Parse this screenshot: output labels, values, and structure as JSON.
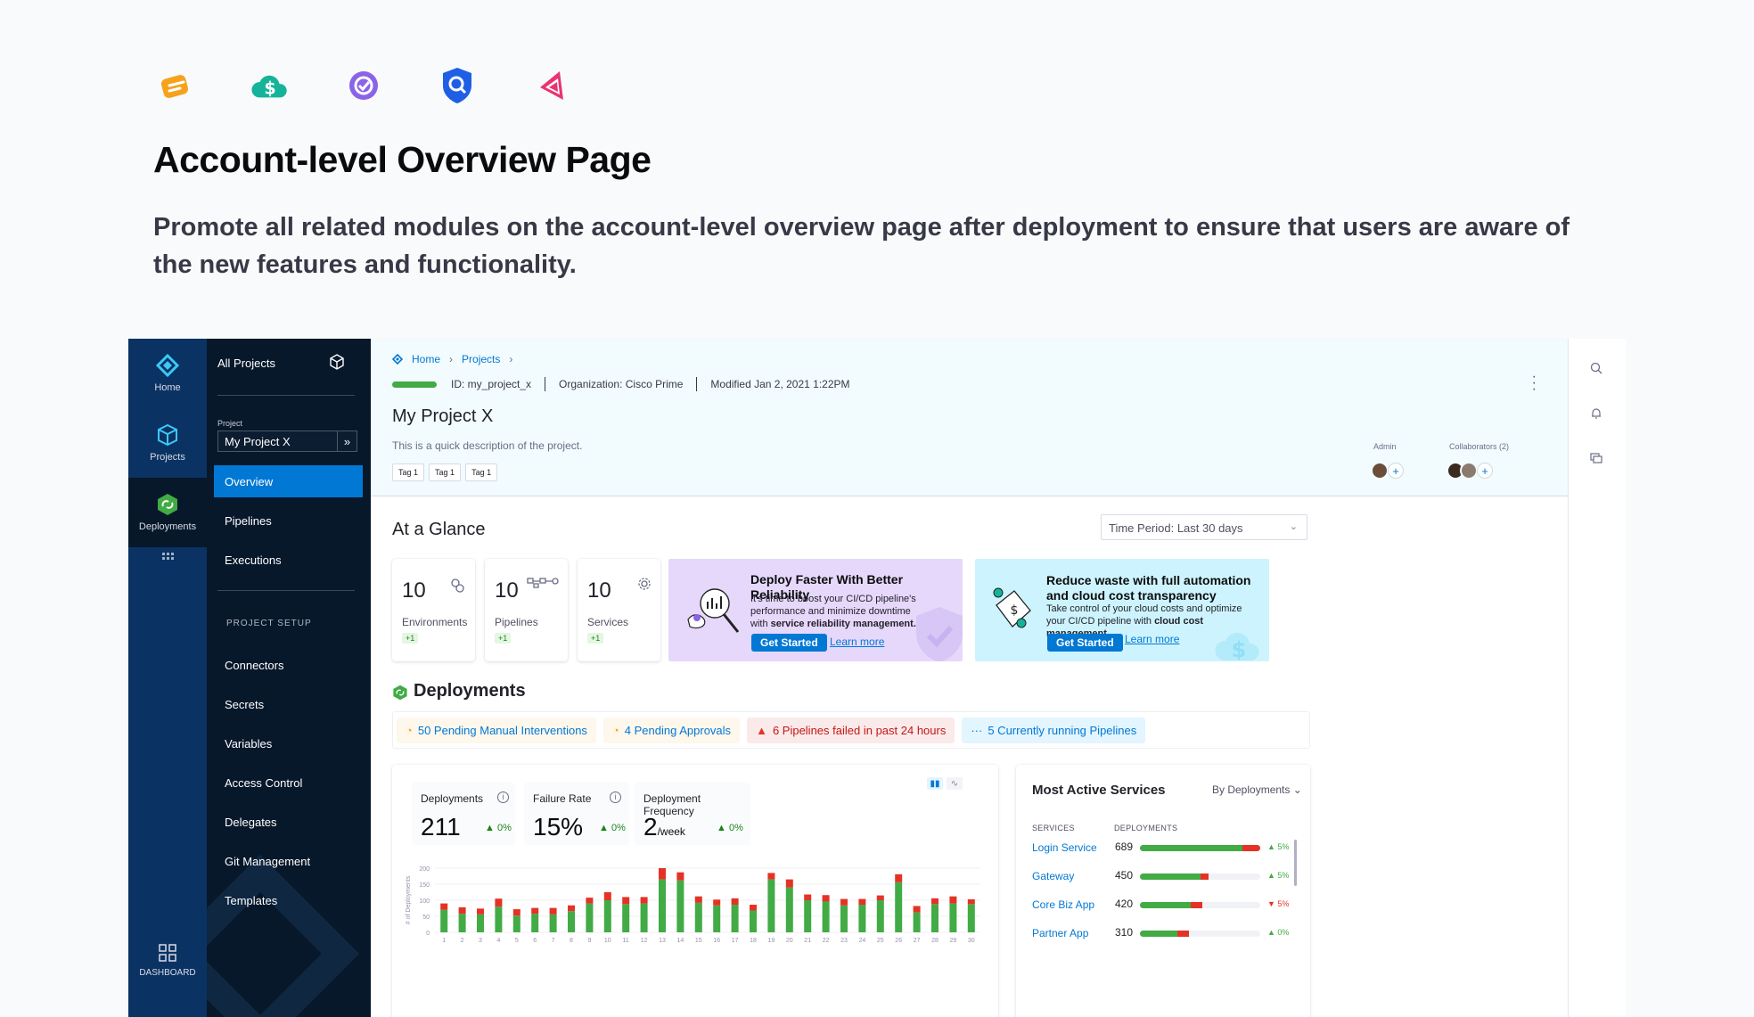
{
  "colors": {
    "accent": "#0278d5",
    "nav_dark": "#0a3364",
    "nav_darker": "#07182b",
    "success": "#42ab45",
    "danger": "#e43326"
  },
  "module_icons": [
    "feature-flags-icon",
    "cloud-cost-icon",
    "service-reliability-icon",
    "security-testing-icon",
    "chaos-engineering-icon"
  ],
  "headline": "Account-level Overview Page",
  "subheadline": "Promote all related modules on the account-level overview page after deployment to ensure that users are aware of the new features and functionality.",
  "nav_primary": {
    "home": "Home",
    "projects": "Projects",
    "deployments": "Deployments",
    "dashboard": "DASHBOARD"
  },
  "nav_secondary": {
    "all_projects": "All Projects",
    "project_label": "Project",
    "project_value": "My Project X",
    "project_chev": "»",
    "links": [
      "Overview",
      "Pipelines",
      "Executions"
    ],
    "setup_title": "PROJECT SETUP",
    "setup_links": [
      "Connectors",
      "Secrets",
      "Variables",
      "Access Control",
      "Delegates",
      "Git Management",
      "Templates"
    ]
  },
  "header": {
    "breadcrumb": [
      "Home",
      "Projects"
    ],
    "id": "ID: my_project_x",
    "org": "Organization: Cisco Prime",
    "modified": "Modified Jan 2, 2021 1:22PM",
    "title": "My Project X",
    "description": "This is a quick description of the project.",
    "tags": [
      "Tag 1",
      "Tag 1",
      "Tag 1"
    ],
    "admin_label": "Admin",
    "collaborators_label": "Collaborators (2)",
    "add": "+"
  },
  "glance": {
    "title": "At a Glance",
    "time_period": "Time Period: Last 30 days",
    "stats": [
      {
        "value": "10",
        "label": "Environments",
        "delta": "+1",
        "icon": "environments-icon"
      },
      {
        "value": "10",
        "label": "Pipelines",
        "delta": "+1",
        "icon": "pipelines-icon"
      },
      {
        "value": "10",
        "label": "Services",
        "delta": "+1",
        "icon": "services-gear-icon"
      }
    ],
    "promo_reliability": {
      "title": "Deploy Faster With Better Reliability",
      "text": "It's time to boost your CI/CD pipeline's performance and minimize downtime with",
      "bold": "service reliability management.",
      "cta": "Get Started",
      "link": "Learn more"
    },
    "promo_cost": {
      "title": "Reduce waste with full automation and cloud cost transparency",
      "text": "Take control of your cloud costs and optimize your CI/CD pipeline with",
      "bold": "cloud cost management.",
      "cta": "Get Started",
      "link": "Learn more"
    }
  },
  "deployments": {
    "title": "Deployments",
    "badges": [
      "50 Pending Manual Interventions",
      "4 Pending Approvals",
      "6 Pipelines failed in past 24 hours",
      "5 Currently running Pipelines"
    ],
    "metrics": [
      {
        "label": "Deployments",
        "value": "211",
        "unit": "",
        "delta": "0%"
      },
      {
        "label": "Failure Rate",
        "value": "15%",
        "unit": "",
        "delta": "0%"
      },
      {
        "label": "Deployment Frequency",
        "value": "2",
        "unit": "/week",
        "delta": "0%"
      }
    ]
  },
  "chart_data": {
    "type": "bar",
    "ylabel": "# of Deployments",
    "ylim": [
      0,
      200
    ],
    "yticks": [
      0,
      50,
      100,
      150,
      200
    ],
    "categories": [
      "1",
      "2",
      "3",
      "4",
      "5",
      "6",
      "7",
      "8",
      "9",
      "10",
      "11",
      "12",
      "13",
      "14",
      "15",
      "16",
      "17",
      "18",
      "19",
      "20",
      "21",
      "22",
      "23",
      "24",
      "25",
      "26",
      "27",
      "28",
      "29",
      "30"
    ],
    "series": [
      {
        "name": "success",
        "color": "#42ab45",
        "values": [
          70,
          58,
          56,
          80,
          52,
          58,
          56,
          66,
          90,
          100,
          88,
          90,
          165,
          162,
          92,
          84,
          86,
          68,
          165,
          140,
          100,
          96,
          84,
          86,
          100,
          156,
          62,
          88,
          90,
          88
        ]
      },
      {
        "name": "failed",
        "color": "#e43326",
        "values": [
          20,
          20,
          18,
          25,
          20,
          18,
          20,
          18,
          18,
          25,
          22,
          20,
          35,
          25,
          20,
          18,
          20,
          18,
          20,
          25,
          18,
          20,
          20,
          18,
          15,
          25,
          20,
          18,
          22,
          15
        ]
      }
    ]
  },
  "services": {
    "title": "Most Active Services",
    "sort": "By Deployments",
    "col_services": "SERVICES",
    "col_deployments": "DEPLOYMENTS",
    "rows": [
      {
        "name": "Login Service",
        "count": "689",
        "green": 0.85,
        "red": 0.15,
        "delta": "5%",
        "dir": "up"
      },
      {
        "name": "Gateway",
        "count": "450",
        "green": 0.5,
        "red": 0.07,
        "delta": "5%",
        "dir": "up"
      },
      {
        "name": "Core Biz App",
        "count": "420",
        "green": 0.42,
        "red": 0.1,
        "delta": "5%",
        "dir": "down"
      },
      {
        "name": "Partner App",
        "count": "310",
        "green": 0.31,
        "red": 0.1,
        "delta": "0%",
        "dir": "up"
      }
    ]
  }
}
